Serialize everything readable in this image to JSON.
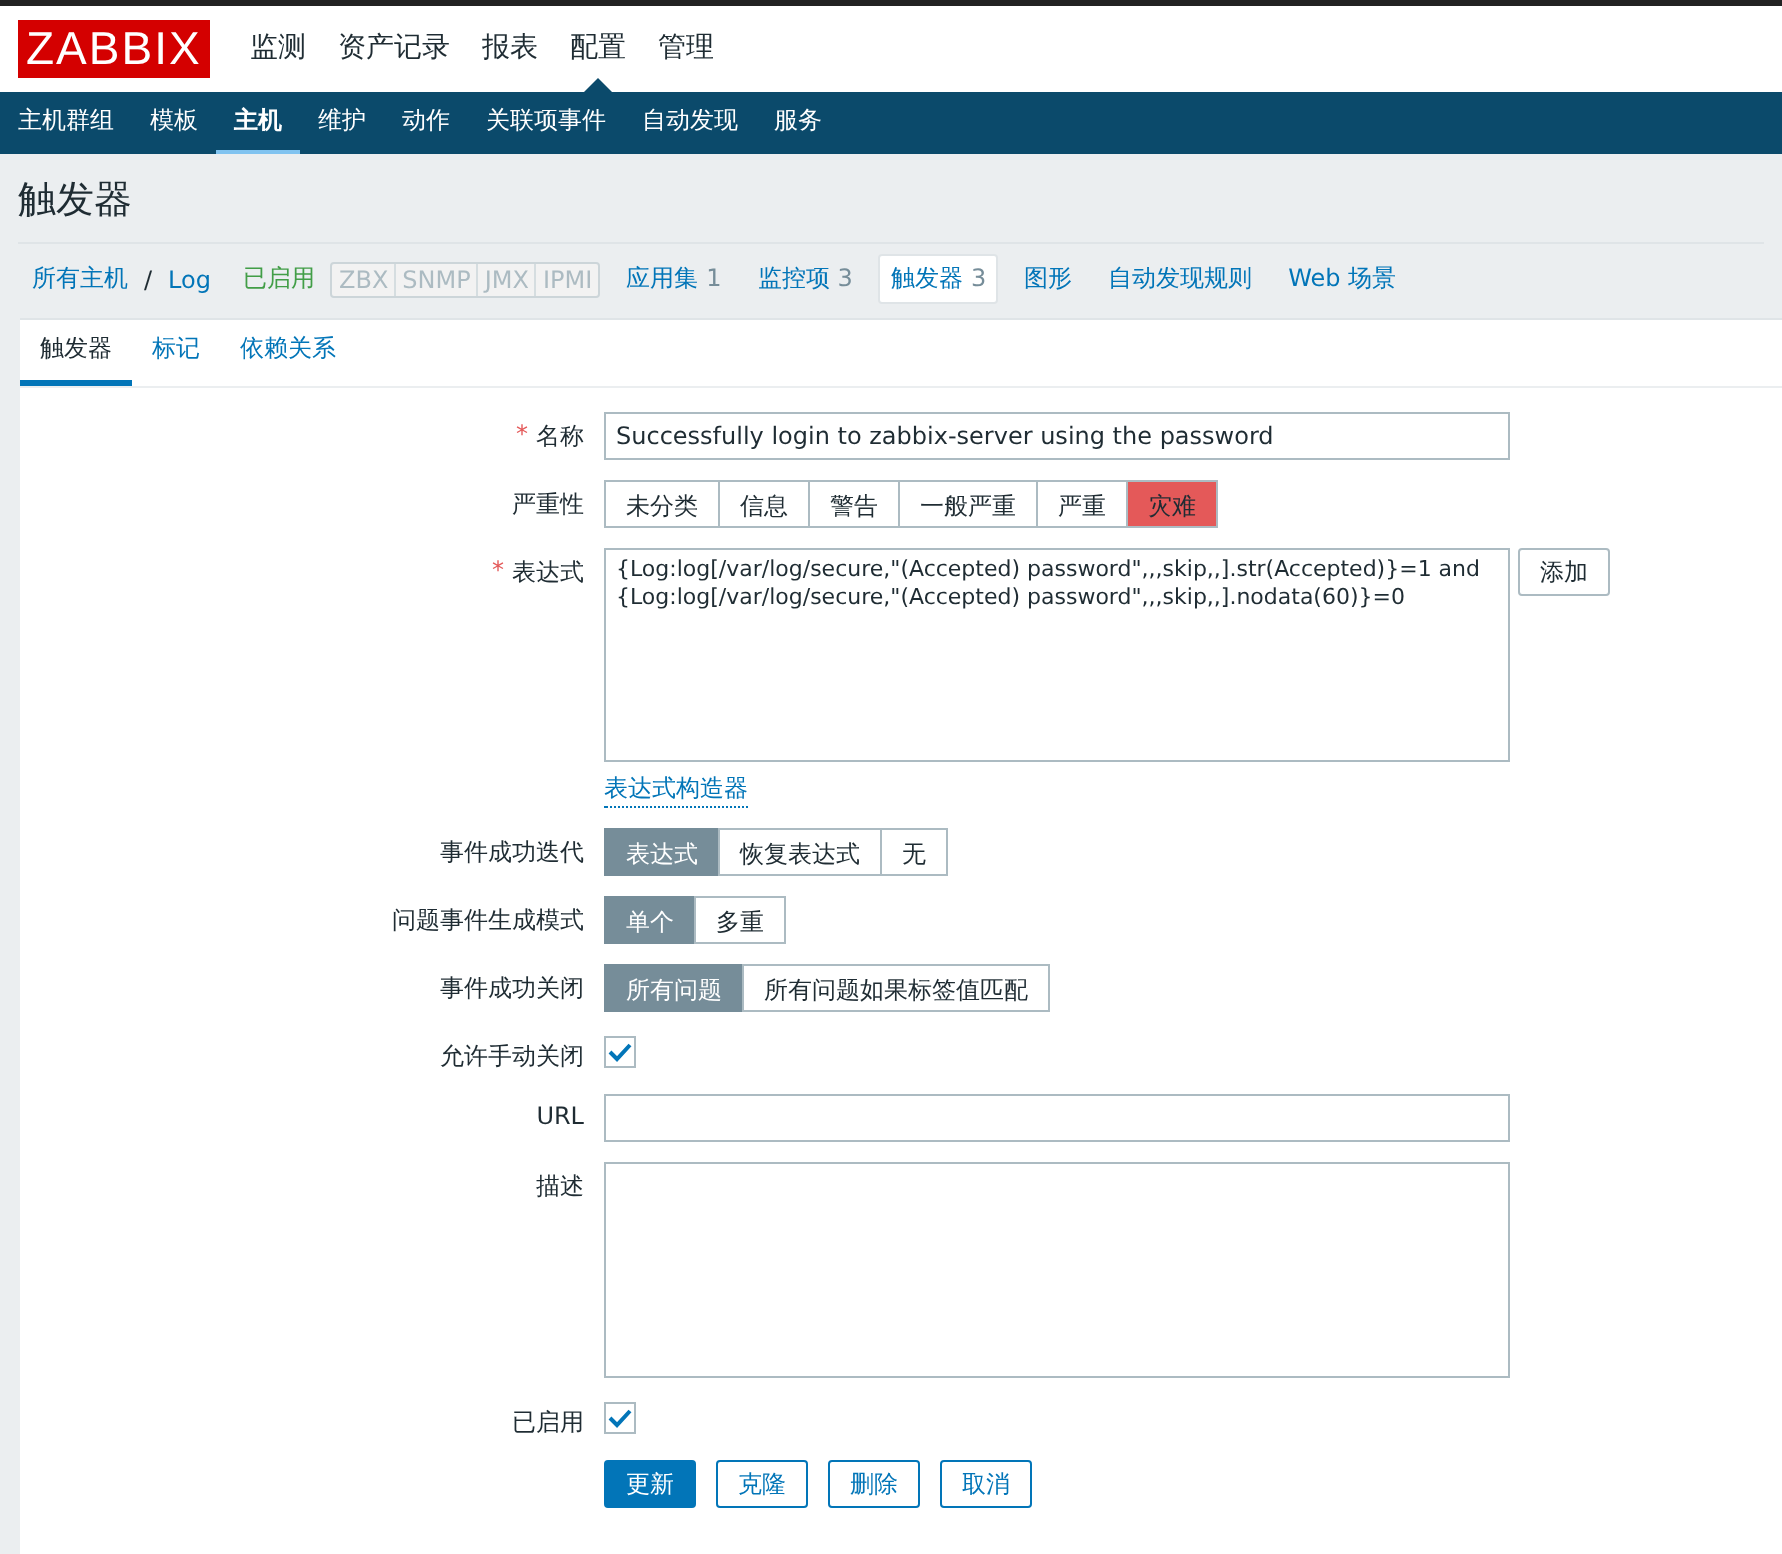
{
  "logo": "ZABBIX",
  "main_menu": [
    {
      "label": "监测",
      "selected": false
    },
    {
      "label": "资产记录",
      "selected": false
    },
    {
      "label": "报表",
      "selected": false
    },
    {
      "label": "配置",
      "selected": true
    },
    {
      "label": "管理",
      "selected": false
    }
  ],
  "sub_menu": [
    {
      "label": "主机群组",
      "selected": false
    },
    {
      "label": "模板",
      "selected": false
    },
    {
      "label": "主机",
      "selected": true
    },
    {
      "label": "维护",
      "selected": false
    },
    {
      "label": "动作",
      "selected": false
    },
    {
      "label": "关联项事件",
      "selected": false
    },
    {
      "label": "自动发现",
      "selected": false
    },
    {
      "label": "服务",
      "selected": false
    }
  ],
  "page_title": "触发器",
  "host_nav": {
    "breadcrumb": [
      "所有主机",
      "/",
      "Log"
    ],
    "status": "已启用",
    "availability": [
      "ZBX",
      "SNMP",
      "JMX",
      "IPMI"
    ],
    "links": [
      {
        "label": "应用集",
        "count": "1",
        "selected": false
      },
      {
        "label": "监控项",
        "count": "3",
        "selected": false
      },
      {
        "label": "触发器",
        "count": "3",
        "selected": true
      },
      {
        "label": "图形",
        "selected": false
      },
      {
        "label": "自动发现规则",
        "selected": false
      },
      {
        "label": "Web 场景",
        "selected": false
      }
    ]
  },
  "tabs": [
    {
      "label": "触发器",
      "selected": true
    },
    {
      "label": "标记",
      "selected": false
    },
    {
      "label": "依赖关系",
      "selected": false
    }
  ],
  "form": [
    {
      "kind": "text",
      "label": "名称",
      "required_mark": "*",
      "value": "Successfully login to zabbix-server using the password"
    },
    {
      "kind": "severity",
      "label": "严重性",
      "options": [
        {
          "label": "未分类",
          "selected": false
        },
        {
          "label": "信息",
          "selected": false
        },
        {
          "label": "警告",
          "selected": false
        },
        {
          "label": "一般严重",
          "selected": false
        },
        {
          "label": "严重",
          "selected": false
        },
        {
          "label": "灾难",
          "selected": true
        }
      ]
    },
    {
      "kind": "expression",
      "label": "表达式",
      "required_mark": "*",
      "lines": [
        "{Log:log[/var/log/secure,\"(Accepted) password\",,,skip,,].str(Accepted)}=1 and",
        "{Log:log[/var/log/secure,\"(Accepted) password\",,,skip,,].nodata(60)}=0"
      ],
      "button": "添加",
      "link": "表达式构造器"
    },
    {
      "kind": "segmented",
      "label": "事件成功迭代",
      "options": [
        {
          "label": "表达式",
          "selected": true
        },
        {
          "label": "恢复表达式",
          "selected": false
        },
        {
          "label": "无",
          "selected": false
        }
      ]
    },
    {
      "kind": "segmented",
      "label": "问题事件生成模式",
      "options": [
        {
          "label": "单个",
          "selected": true
        },
        {
          "label": "多重",
          "selected": false
        }
      ]
    },
    {
      "kind": "segmented",
      "label": "事件成功关闭",
      "options": [
        {
          "label": "所有问题",
          "selected": true
        },
        {
          "label": "所有问题如果标签值匹配",
          "selected": false
        }
      ]
    },
    {
      "kind": "checkbox",
      "label": "允许手动关闭",
      "checked": true
    },
    {
      "kind": "text",
      "label": "URL"
    },
    {
      "kind": "textarea",
      "label": "描述"
    },
    {
      "kind": "checkbox",
      "label": "已启用",
      "checked": true
    }
  ],
  "buttons": [
    {
      "label": "更新",
      "kind": "primary"
    },
    {
      "label": "克隆",
      "kind": "secondary"
    },
    {
      "label": "删除",
      "kind": "secondary"
    },
    {
      "label": "取消",
      "kind": "secondary"
    }
  ]
}
